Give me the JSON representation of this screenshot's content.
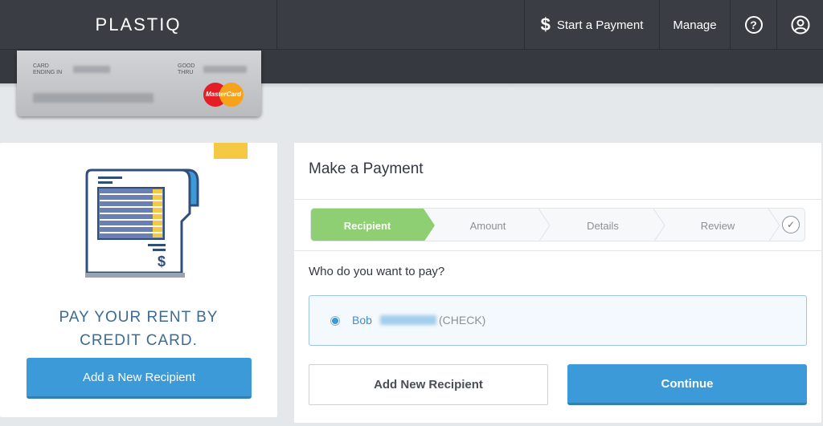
{
  "header": {
    "logo": "PLASTIQ",
    "nav": {
      "start_payment_icon": "$",
      "start_payment_label": "Start a Payment",
      "manage_label": "Manage",
      "help_icon_glyph": "?",
      "user_icon_name": "user-icon"
    }
  },
  "card": {
    "ending_label_1": "CARD",
    "ending_label_2": "ENDING IN",
    "good_thru_1": "GOOD",
    "good_thru_2": "THRU",
    "brand": "MasterCard"
  },
  "promo": {
    "line1": "PAY YOUR RENT BY",
    "line2": "CREDIT CARD.",
    "button": "Add a New Recipient"
  },
  "payment": {
    "title": "Make a Payment",
    "steps": [
      "Recipient",
      "Amount",
      "Details",
      "Review"
    ],
    "active_step": 0,
    "question": "Who do you want to pay?",
    "recipient": {
      "first_name": "Bob",
      "type": "(CHECK)",
      "selected": true
    },
    "add_button": "Add New Recipient",
    "continue_button": "Continue"
  },
  "colors": {
    "accent": "#3d9ad8",
    "active_step": "#8fcf73",
    "nav_bg": "#3a3d44",
    "promo_text": "#3c6b94",
    "yellow": "#f6c945"
  }
}
